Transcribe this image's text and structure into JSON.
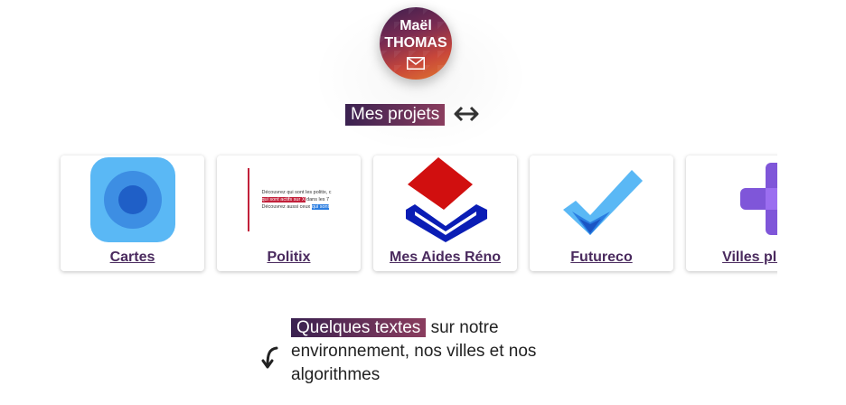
{
  "profile": {
    "first_name": "Maël",
    "last_name": "THOMAS",
    "mail_icon": "envelope-icon"
  },
  "projects": {
    "title": "Mes projets",
    "scroll_icon": "left-right-arrow-icon",
    "items": [
      {
        "label": "Cartes",
        "icon": "map-target-icon"
      },
      {
        "label": "Politix",
        "icon": "politix-preview-image",
        "preview_lines": [
          "Découvrez qui sont les politix, c",
          "qui sont actifs sur X",
          "dans les 7",
          "Découvrez aussi ceux",
          "qui sont"
        ]
      },
      {
        "label": "Mes Aides Réno",
        "icon": "house-logo-icon"
      },
      {
        "label": "Futureco",
        "icon": "checkmark-icon"
      },
      {
        "label": "Villes plus",
        "icon": "plus-icon"
      }
    ]
  },
  "texts": {
    "highlight": "Quelques textes",
    "rest": " sur notre environnement, nos villes et nos algorithmes",
    "arrow_icon": "curved-arrow-icon"
  },
  "colors": {
    "accent_dark": "#3a2150",
    "accent_light": "#8a3d5e",
    "label": "#4a2a5e"
  }
}
